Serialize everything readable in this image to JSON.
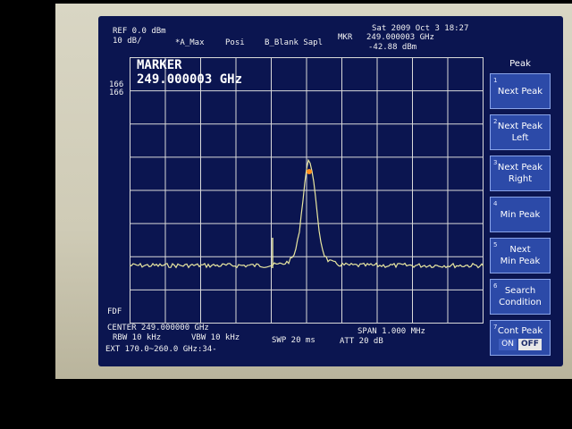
{
  "header": {
    "ref": "REF 0.0 dBm",
    "scale": "10 dB/",
    "trace_mode": "*A_Max",
    "pos": "Posi",
    "blank": "B_Blank Sapl",
    "date": "Sat 2009 Oct  3 18:27",
    "mkr_label": "MKR",
    "mkr_freq": "249.000003 GHz",
    "mkr_level": "-42.88 dBm"
  },
  "marker_box": {
    "title": "MARKER",
    "freq": "249.000003 GHz"
  },
  "side_labels": {
    "top1": "166",
    "top2": "166",
    "bottom": "FDF"
  },
  "status": {
    "center": "CENTER 249.000000 GHz",
    "rbw": "RBW 10 kHz",
    "vbw": "VBW 10 kHz",
    "swp": "SWP 20 ms",
    "span": "SPAN 1.000 MHz",
    "att": "ATT 20 dB",
    "ext": "EXT 170.0~260.0 GHz:34-"
  },
  "softkeys": {
    "title": "Peak",
    "keys": [
      {
        "num": "1",
        "line1": "Next Peak",
        "line2": ""
      },
      {
        "num": "2",
        "line1": "Next Peak",
        "line2": "Left"
      },
      {
        "num": "3",
        "line1": "Next Peak",
        "line2": "Right"
      },
      {
        "num": "4",
        "line1": "Min Peak",
        "line2": ""
      },
      {
        "num": "5",
        "line1": "Next",
        "line2": "Min Peak"
      },
      {
        "num": "6",
        "line1": "Search",
        "line2": "Condition"
      },
      {
        "num": "7",
        "line1": "Cont Peak",
        "on": "ON",
        "off": "OFF"
      }
    ]
  },
  "colors": {
    "screen_bg": "#0b1550",
    "trace": "#e8e6a0",
    "marker": "#ff8c1a",
    "grid": "#d9d9d9",
    "softkey_bg": "#2c4aa8"
  }
}
